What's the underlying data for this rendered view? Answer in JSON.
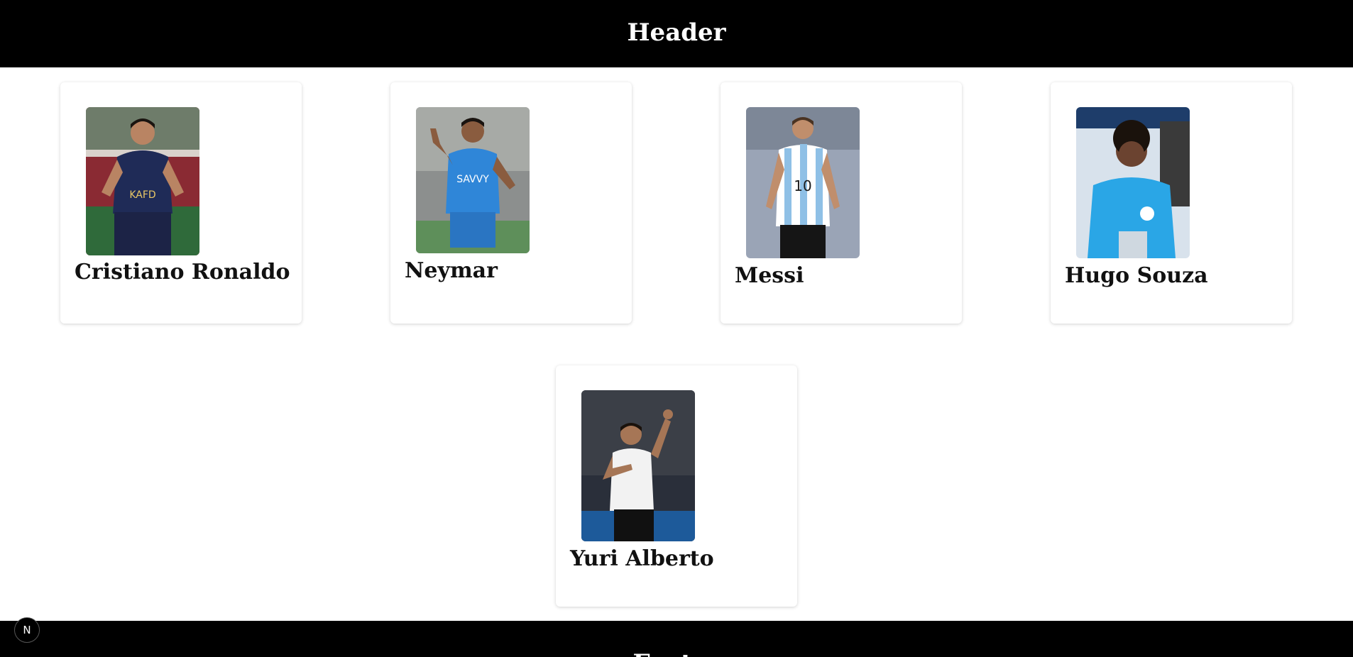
{
  "header": {
    "title": "Header"
  },
  "players": [
    {
      "name": "Cristiano Ronaldo",
      "photo_desc": "player-photo",
      "jersey_color": "#1f2b57",
      "bg_color": "#7a8a72"
    },
    {
      "name": "Neymar",
      "photo_desc": "player-photo",
      "jersey_color": "#2f86d8",
      "bg_color": "#8c8f8e"
    },
    {
      "name": "Messi",
      "photo_desc": "player-photo",
      "jersey_color": "#a9cdea",
      "bg_color": "#9aa4b6"
    },
    {
      "name": "Hugo Souza",
      "photo_desc": "player-photo",
      "jersey_color": "#2aa6e6",
      "bg_color": "#d8e2ec"
    },
    {
      "name": "Yuri Alberto",
      "photo_desc": "player-photo",
      "jersey_color": "#f2f2f2",
      "bg_color": "#2a2f3a"
    }
  ],
  "footer": {
    "label": "Footer"
  },
  "dev_badge": {
    "label": "N"
  }
}
